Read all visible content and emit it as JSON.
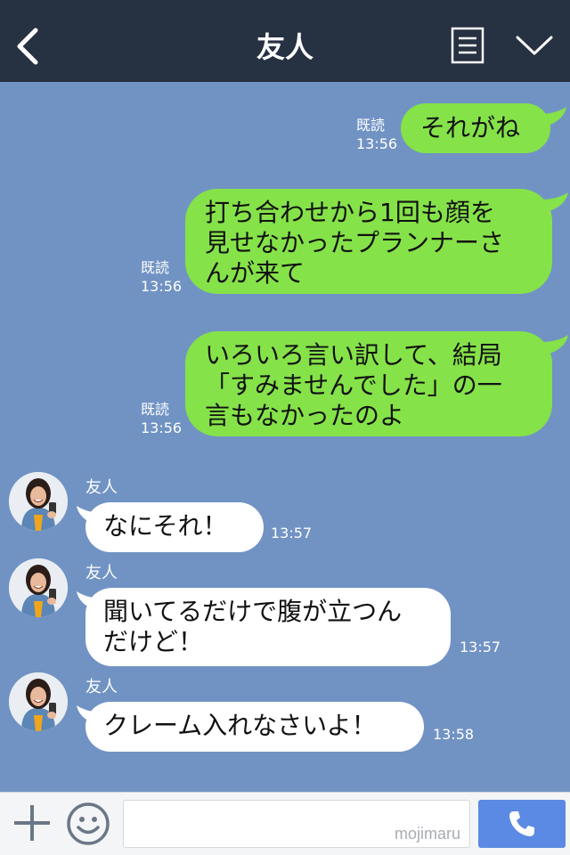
{
  "header": {
    "title": "友人"
  },
  "messages": {
    "m1": {
      "text": "それがね",
      "read": "既読",
      "time": "13:56"
    },
    "m2": {
      "line1": "打ち合わせから1回も顔を",
      "line2": "見せなかったプランナーさ",
      "line3": "んが来て",
      "read": "既読",
      "time": "13:56"
    },
    "m3": {
      "line1": "いろいろ言い訳して、結局",
      "line2": "「すみませんでした」の一",
      "line3": "言もなかったのよ",
      "read": "既読",
      "time": "13:56"
    },
    "m4": {
      "sender": "友人",
      "text": "なにそれ！",
      "time": "13:57"
    },
    "m5": {
      "sender": "友人",
      "line1": "聞いてるだけで腹が立つん",
      "line2": "だけど！",
      "time": "13:57"
    },
    "m6": {
      "sender": "友人",
      "text": "クレーム入れなさいよ！",
      "time": "13:58"
    }
  },
  "inputbar": {
    "watermark": "mojimaru"
  },
  "colors": {
    "header_bg": "#263142",
    "chat_bg": "#7193c4",
    "bubble_sent": "#85e249",
    "bubble_received": "#ffffff",
    "call_button": "#5a8ae3"
  },
  "icons": [
    "back-chevron-icon",
    "menu-list-icon",
    "chevron-down-icon",
    "plus-icon",
    "smiley-icon",
    "phone-icon"
  ]
}
